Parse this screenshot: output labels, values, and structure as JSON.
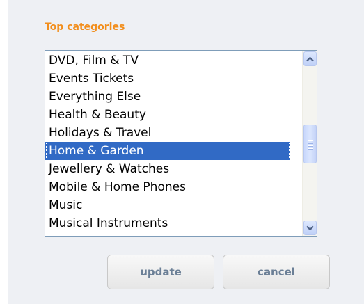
{
  "section": {
    "title": "Top categories"
  },
  "categories": {
    "items": [
      "DVD, Film & TV",
      "Events Tickets",
      "Everything Else",
      "Health & Beauty",
      "Holidays & Travel",
      "Home & Garden",
      "Jewellery & Watches",
      "Mobile & Home Phones",
      "Music",
      "Musical Instruments"
    ],
    "selected": "Home & Garden",
    "scroll_position": 0.45
  },
  "actions": {
    "update_label": "update",
    "cancel_label": "cancel"
  },
  "colors": {
    "title": "#f28e1c",
    "selection": "#316ac5",
    "button_text": "#6b7f96",
    "panel_background": "#eef0f4"
  }
}
